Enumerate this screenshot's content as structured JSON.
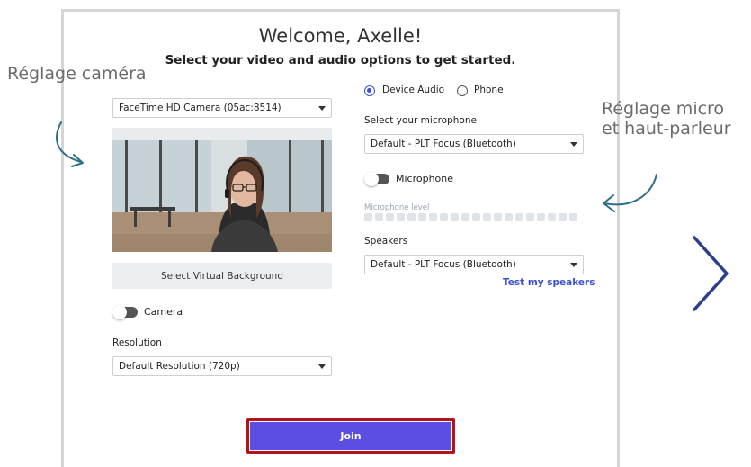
{
  "header": {
    "title": "Welcome, Axelle!",
    "subtitle": "Select your video and audio options to get started."
  },
  "annotations": {
    "camera_settings": "Réglage caméra",
    "mic_line1": "Réglage micro",
    "mic_line2": "et haut-parleur"
  },
  "video": {
    "camera_select": "FaceTime HD Camera (05ac:8514)",
    "virtual_bg_button": "Select Virtual Background",
    "camera_toggle_label": "Camera",
    "camera_on": false,
    "resolution_label": "Resolution",
    "resolution_select": "Default Resolution (720p)"
  },
  "audio": {
    "options": [
      "Device Audio",
      "Phone"
    ],
    "selected_option": "Device Audio",
    "microphone_label": "Select your microphone",
    "microphone_select": "Default - PLT Focus (Bluetooth)",
    "microphone_toggle_label": "Microphone",
    "microphone_on": false,
    "microphone_level_label": "Microphone level",
    "microphone_level": 0,
    "speakers_label": "Speakers",
    "speakers_select": "Default - PLT Focus (Bluetooth)",
    "test_speakers": "Test my speakers"
  },
  "actions": {
    "join": "Join"
  },
  "colors": {
    "accent": "#3b4fd6",
    "join_button": "#5a4fe0",
    "join_outline": "#b5121b",
    "annotation_arrow": "#2e6f86"
  }
}
